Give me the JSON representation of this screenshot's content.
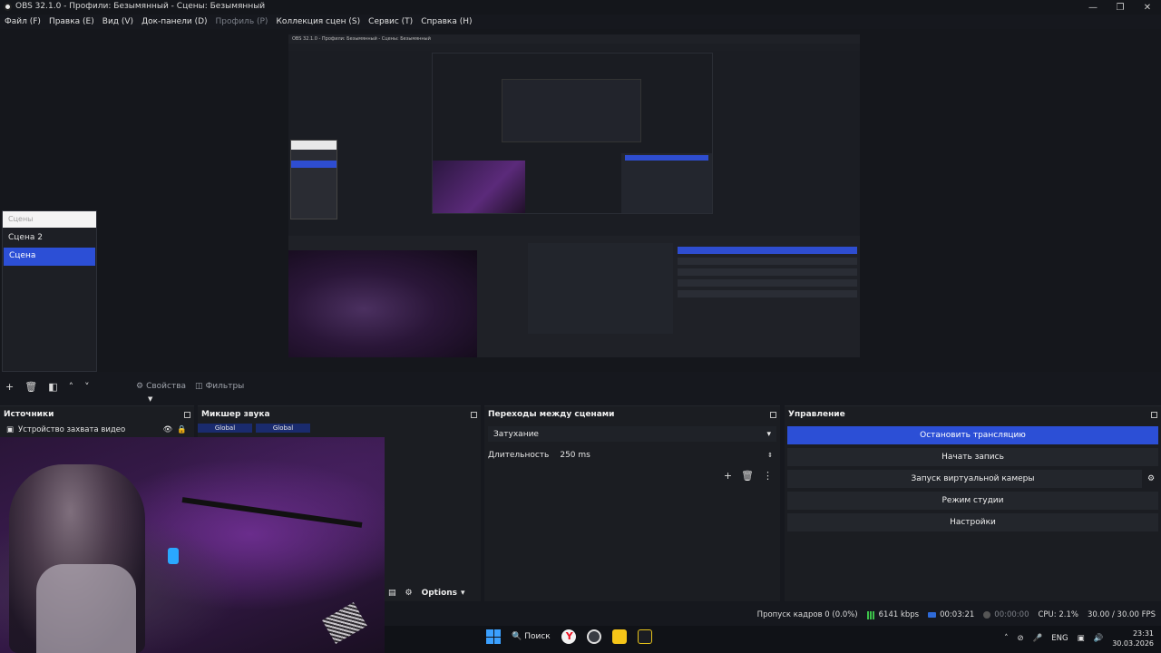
{
  "window": {
    "title": "OBS 32.1.0 - Профили: Безымянный - Сцены: Безымянный"
  },
  "menu": [
    {
      "label": "Файл (F)",
      "disabled": false
    },
    {
      "label": "Правка (E)",
      "disabled": false
    },
    {
      "label": "Вид (V)",
      "disabled": false
    },
    {
      "label": "Док-панели (D)",
      "disabled": false
    },
    {
      "label": "Профиль (P)",
      "disabled": true
    },
    {
      "label": "Коллекция сцен (S)",
      "disabled": false
    },
    {
      "label": "Сервис (T)",
      "disabled": false
    },
    {
      "label": "Справка (H)",
      "disabled": false
    }
  ],
  "scenes": {
    "header": "Сцены",
    "items": [
      "Сцена 2",
      "Сцена"
    ],
    "selected_index": 1
  },
  "propbar": {
    "properties": "Свойства",
    "filters": "Фильтры"
  },
  "sources": {
    "title": "Источники",
    "items": [
      {
        "label": "Устройство захвата видео"
      }
    ]
  },
  "mixer": {
    "title": "Микшер звука",
    "channels": [
      "Global",
      "Global"
    ],
    "options_label": "Options"
  },
  "transitions": {
    "title": "Переходы между сценами",
    "selected": "Затухание",
    "duration_label": "Длительность",
    "duration_value": "250 ms"
  },
  "controls": {
    "title": "Управление",
    "buttons": [
      {
        "label": "Остановить трансляцию",
        "active": true
      },
      {
        "label": "Начать запись",
        "active": false
      },
      {
        "label": "Запуск виртуальной камеры",
        "active": false
      },
      {
        "label": "Режим студии",
        "active": false
      },
      {
        "label": "Настройки",
        "active": false
      }
    ]
  },
  "status": {
    "dropped_frames": "Пропуск кадров 0 (0.0%)",
    "bitrate": "6141 kbps",
    "stream_time": "00:03:21",
    "record_time": "00:00:00",
    "cpu": "CPU: 2.1%",
    "fps": "30.00 / 30.00 FPS"
  },
  "taskbar": {
    "search": "Поиск",
    "lang": "ENG",
    "time": "23:31",
    "date": "30.03.2026"
  },
  "preview_text": {
    "scenes_header": "Сцены",
    "inner_title": "OBS 32.1.0 - Профили: Безымянный - Сцены: Безымянный"
  }
}
